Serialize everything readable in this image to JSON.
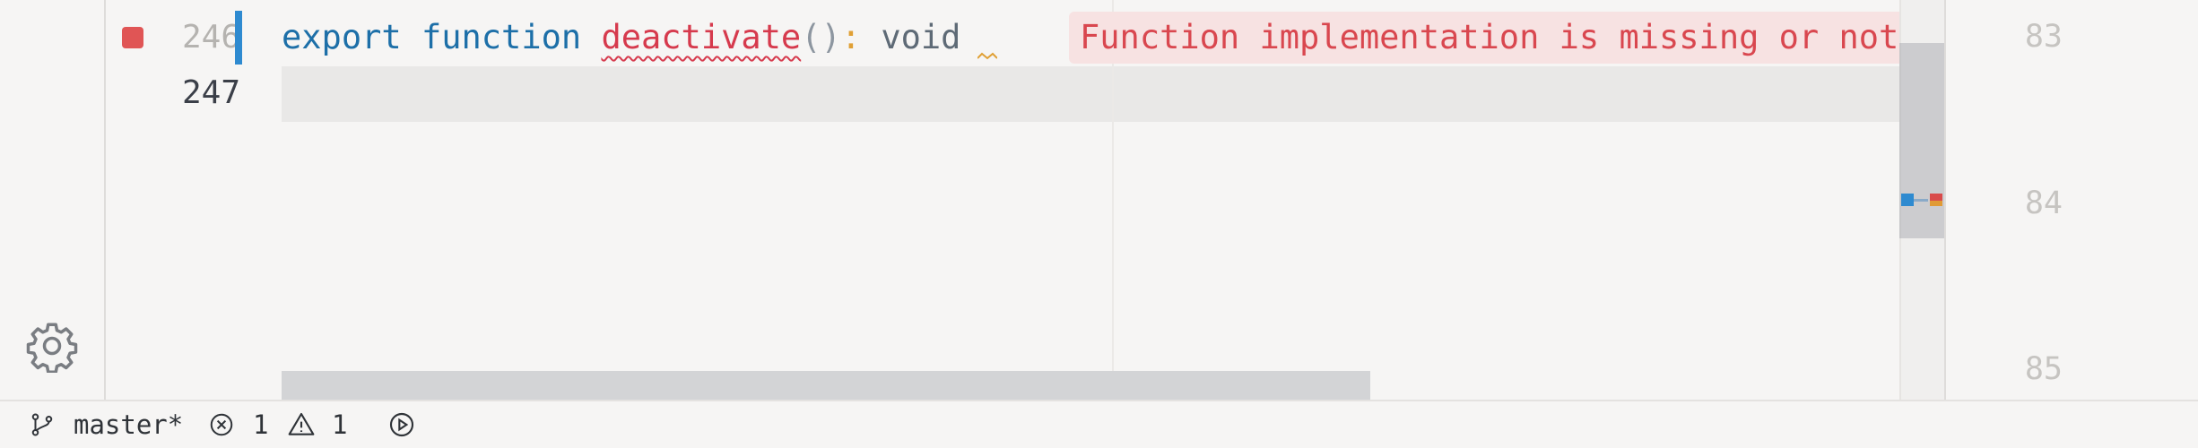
{
  "editor": {
    "lines": [
      {
        "number": "246",
        "tokens": {
          "keyword_export": "export",
          "keyword_function": "function",
          "function_name": "deactivate",
          "parens": "()",
          "colon": ":",
          "return_type": "void"
        }
      },
      {
        "number": "247",
        "text": ""
      }
    ],
    "error_lens_message": "Function implementation is missing or not"
  },
  "right_gutter": {
    "numbers": [
      "83",
      "84",
      "85"
    ]
  },
  "statusbar": {
    "branch": "master*",
    "errors": "1",
    "warnings": "1"
  },
  "colors": {
    "background": "#f6f5f4",
    "keyword": "#1d6fa8",
    "error": "#d63a4d",
    "warning": "#e0a035",
    "modified": "#2e8ad0"
  },
  "icons": [
    "gear-icon",
    "git-branch-icon",
    "error-icon",
    "warning-icon",
    "run-icon"
  ]
}
